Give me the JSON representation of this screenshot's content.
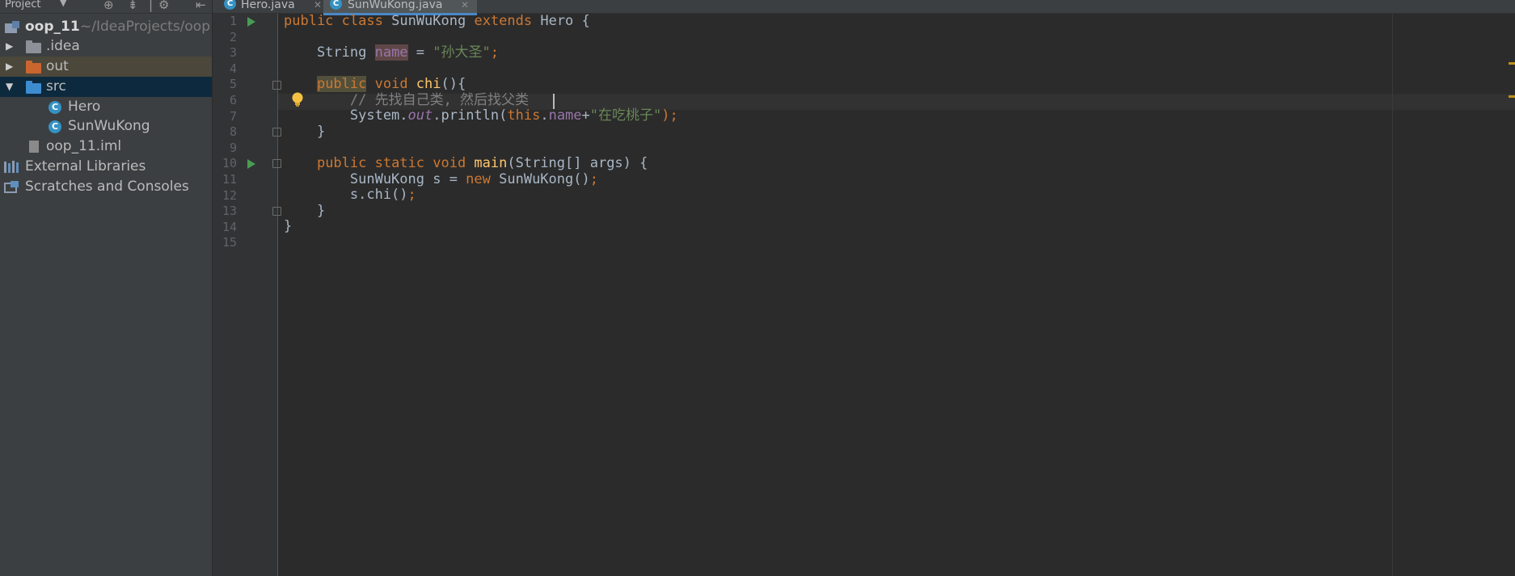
{
  "project_panel": {
    "title": "Project",
    "tree": [
      {
        "label": "oop_11",
        "path": "~/IdeaProjects/oop",
        "icon": "module-icon"
      },
      {
        "label": ".idea",
        "icon": "folder-icon"
      },
      {
        "label": "out",
        "icon": "folder-icon"
      },
      {
        "label": "src",
        "icon": "folder-icon"
      },
      {
        "label": "Hero",
        "icon": "class-icon"
      },
      {
        "label": "SunWuKong",
        "icon": "class-icon"
      },
      {
        "label": "oop_11.iml",
        "icon": "file-icon"
      },
      {
        "label": "External Libraries",
        "icon": "library-icon"
      },
      {
        "label": "Scratches and Consoles",
        "icon": "scratches-icon"
      }
    ]
  },
  "tabs": [
    {
      "label": "Hero.java",
      "active": false
    },
    {
      "label": "SunWuKong.java",
      "active": true
    }
  ],
  "editor": {
    "line_numbers": [
      "1",
      "2",
      "3",
      "4",
      "5",
      "6",
      "7",
      "8",
      "9",
      "10",
      "11",
      "12",
      "13",
      "14",
      "15"
    ],
    "tokens": {
      "l1": {
        "public": "public",
        "class": "class",
        "name": " SunWuKong ",
        "extends": "extends",
        "rest": " Hero {"
      },
      "l3": {
        "type": "    String ",
        "field": "name",
        "eq": " = ",
        "str": "\"孙大圣\"",
        "semi": ";"
      },
      "l5": {
        "indent": "    ",
        "public": "public",
        "void": " void ",
        "fn": "chi",
        "rest": "(){"
      },
      "l6": {
        "comment": "        // 先找自己类, 然后找父类"
      },
      "l7": {
        "a": "        System.",
        "out": "out",
        "b": ".println(",
        "this": "this",
        "dot": ".",
        "field": "name",
        "plus": "+",
        "str": "\"在吃桃子\"",
        "end": ");"
      },
      "l8": {
        "text": "    }"
      },
      "l10": {
        "indent": "    ",
        "kw": "public static void ",
        "fn": "main",
        "rest": "(String[] args) {"
      },
      "l11": {
        "a": "        SunWuKong s = ",
        "new": "new",
        "b": " SunWuKong()",
        "semi": ";"
      },
      "l12": {
        "a": "        s.chi()",
        "semi": ";"
      },
      "l13": {
        "text": "    }"
      },
      "l14": {
        "text": "}"
      }
    }
  },
  "colors": {
    "background": "#2b2b2b",
    "keyword": "#cc7832",
    "string": "#6a8759",
    "field": "#9876aa",
    "function": "#ffc66d",
    "comment": "#808080",
    "selection": "#0d293e"
  }
}
